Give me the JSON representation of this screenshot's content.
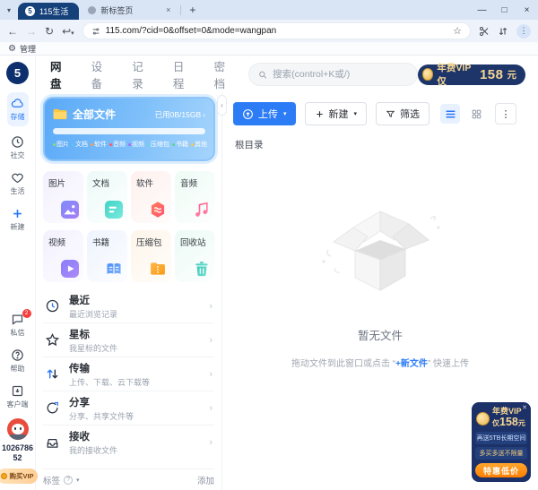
{
  "colors": {
    "accent": "#2777f8",
    "brand_navy": "#0d2f6e",
    "vip_navy": "#1d3569",
    "vip_gold": "#f6d692",
    "promo_orange": "#ff8c1a"
  },
  "browser": {
    "tab1": "115生活",
    "tab2": "新标签页",
    "url": "115.com/?cid=0&offset=0&mode=wangpan",
    "manage": "管理"
  },
  "rail": {
    "logo": "5",
    "storage": "存储",
    "social": "社交",
    "life": "生活",
    "create": "新建",
    "messages": "私信",
    "messages_badge": "2",
    "help": "帮助",
    "client": "客户端",
    "user_id": "102678652",
    "buy_vip": "购买VIP"
  },
  "header": {
    "tabs": [
      {
        "label": "网盘"
      },
      {
        "label": "设备"
      },
      {
        "label": "记录"
      },
      {
        "label": "日程"
      },
      {
        "label": "密档"
      }
    ],
    "search_placeholder": "搜索(control+K或/)",
    "vip": {
      "prefix": "年费VIP仅",
      "price": "158",
      "suffix": "元"
    }
  },
  "storage_card": {
    "title": "全部文件",
    "usage": "已用0B/15GB",
    "legend": [
      {
        "label": "图片",
        "color": "#86e36b"
      },
      {
        "label": "文档",
        "color": "#55c7f0"
      },
      {
        "label": "软件",
        "color": "#ff9f43"
      },
      {
        "label": "音频",
        "color": "#ff5a5f"
      },
      {
        "label": "视频",
        "color": "#b06cf5"
      },
      {
        "label": "压缩包",
        "color": "#6bd5e1"
      },
      {
        "label": "书籍",
        "color": "#5cd68a"
      },
      {
        "label": "其他",
        "color": "#ffc53d"
      }
    ]
  },
  "categories": [
    {
      "label": "图片"
    },
    {
      "label": "文档"
    },
    {
      "label": "软件"
    },
    {
      "label": "音频"
    },
    {
      "label": "视频"
    },
    {
      "label": "书籍"
    },
    {
      "label": "压缩包"
    },
    {
      "label": "回收站"
    }
  ],
  "shortcuts": [
    {
      "title": "最近",
      "subtitle": "最近浏览记录"
    },
    {
      "title": "星标",
      "subtitle": "我星标的文件"
    },
    {
      "title": "传输",
      "subtitle": "上传、下载、云下载等"
    },
    {
      "title": "分享",
      "subtitle": "分享、共享文件等"
    },
    {
      "title": "接收",
      "subtitle": "我的接收文件"
    }
  ],
  "tags_bar": {
    "label": "标签",
    "add": "添加"
  },
  "content": {
    "upload": "上传",
    "new": "新建",
    "filter": "筛选",
    "breadcrumb": "根目录",
    "empty_title": "暂无文件",
    "hint_prefix": "拖动文件到此窗口或点击 “",
    "hint_link": "+新文件",
    "hint_suffix": "” 快速上传"
  },
  "promo": {
    "title": "年费VIP",
    "price_prefix": "仅",
    "price": "158",
    "price_suffix": "元",
    "line2": "再送5TB长期空间",
    "line3": "多买多送不限量",
    "button": "特惠低价"
  }
}
